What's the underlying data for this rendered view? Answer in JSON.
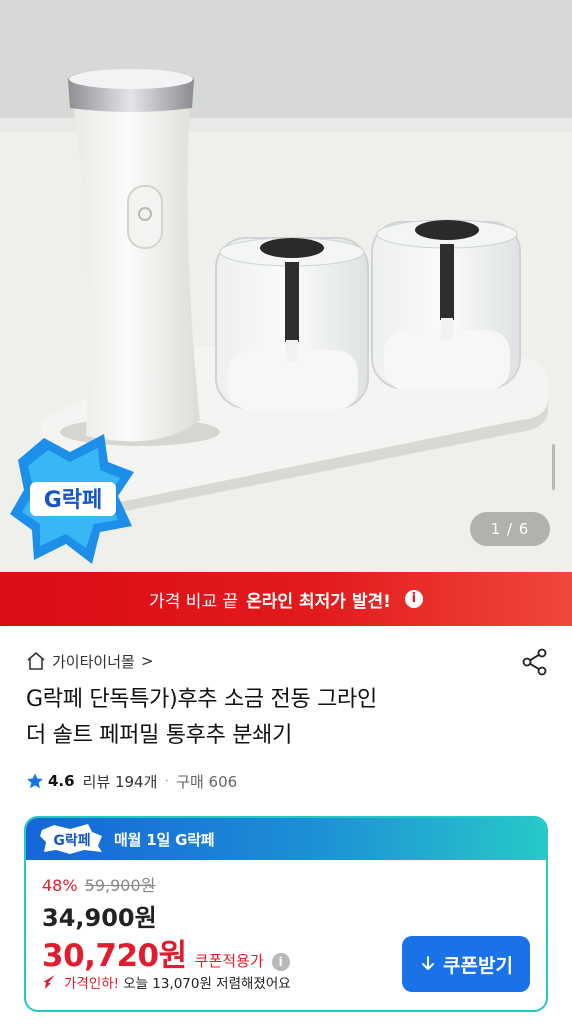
{
  "gallery": {
    "counter": "1 / 6",
    "badge_text": "G락페"
  },
  "banner": {
    "text_light": "가격 비교 끝",
    "text_bold": "온라인 최저가 발견!",
    "info_glyph": "i"
  },
  "seller": {
    "name": "가이타이너몰",
    "chevron": ">"
  },
  "product": {
    "title_line1": "G락페 단독특가)후추 소금 전동 그라인",
    "title_line2": "더 솔트 페퍼밀 통후추 분쇄기",
    "rating": "4.6",
    "reviews": "리뷰 194개",
    "separator": "·",
    "purchases": "구매 606"
  },
  "promo": {
    "badge_text": "G락페",
    "header": "매월 1일 G락페",
    "discount_pct": "48%",
    "original_price": "59,900원",
    "sale_price": "34,900원",
    "coupon_price": "30,720원",
    "coupon_label": "쿠폰적용가",
    "info_glyph": "i",
    "price_drop_lead": "가격인하!",
    "price_drop_text": "오늘 13,070원 저렴해졌어요",
    "coupon_button": "쿠폰받기"
  },
  "colors": {
    "banner_red": "#e21a1d",
    "accent_blue": "#1a72e8",
    "price_red": "#e11d2d",
    "card_border": "#26c6c6"
  },
  "icons": {
    "store": "store-icon",
    "share": "share-icon",
    "star": "star-icon",
    "down_arrow": "down-arrow-icon",
    "info": "info-icon"
  }
}
